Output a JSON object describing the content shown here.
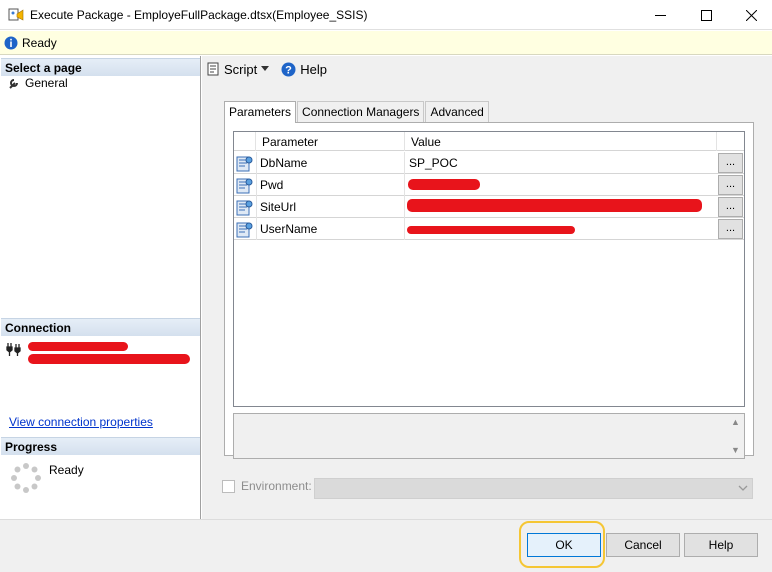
{
  "window": {
    "title": "Execute Package - EmployeFullPackage.dtsx(Employee_SSIS)",
    "icon": "ssis-package-icon",
    "controls": [
      "minimize-icon",
      "maximize-icon",
      "close-icon"
    ]
  },
  "statusbar": {
    "text": "Ready",
    "icon": "info-icon"
  },
  "left": {
    "select_page": "Select a page",
    "pages": [
      {
        "label": "General",
        "icon": "wrench-icon"
      }
    ],
    "connection": "Connection",
    "connection_icon": "connection-plug-icon",
    "view_connection": "View connection properties",
    "progress": "Progress",
    "progress_status": "Ready"
  },
  "toolbar": {
    "script": "Script",
    "help": "Help"
  },
  "tabs": [
    {
      "label": "Parameters",
      "active": true
    },
    {
      "label": "Connection Managers",
      "active": false
    },
    {
      "label": "Advanced",
      "active": false
    }
  ],
  "grid": {
    "columns": [
      "Parameter",
      "Value"
    ],
    "rows": [
      {
        "name": "DbName",
        "value": "SP_POC",
        "redacted": false
      },
      {
        "name": "Pwd",
        "value": "",
        "redacted": true
      },
      {
        "name": "SiteUrl",
        "value": "",
        "redacted": true
      },
      {
        "name": "UserName",
        "value": "",
        "redacted": true
      }
    ],
    "ellipsis": "..."
  },
  "environment": {
    "label": "Environment:",
    "enabled": false,
    "value": ""
  },
  "buttons": {
    "ok": "OK",
    "cancel": "Cancel",
    "help": "Help"
  },
  "colors": {
    "accent": "#0078d7",
    "highlight": "#f5c634",
    "redaction": "#e8141b",
    "status_bg": "#ffffe1"
  }
}
